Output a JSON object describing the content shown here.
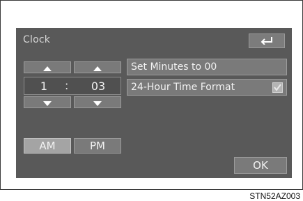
{
  "screen": {
    "title": "Clock"
  },
  "clock": {
    "hour": "1",
    "separator": ":",
    "minute": "03"
  },
  "options": [
    {
      "label": "Set Minutes to 00"
    },
    {
      "label": "24-Hour Time Format",
      "checked": true
    }
  ],
  "period": {
    "am_label": "AM",
    "pm_label": "PM",
    "selected": "AM"
  },
  "actions": {
    "ok_label": "OK"
  },
  "icons": {
    "back": "back-arrow-icon",
    "up": "up-arrow-icon",
    "down": "down-arrow-icon",
    "check": "checkbox-icon"
  },
  "footer": {
    "code": "STN52AZ003"
  },
  "colors": {
    "screen_bg": "#595959",
    "button": "#7a7a7a",
    "selected_button": "#a4a4a4"
  }
}
